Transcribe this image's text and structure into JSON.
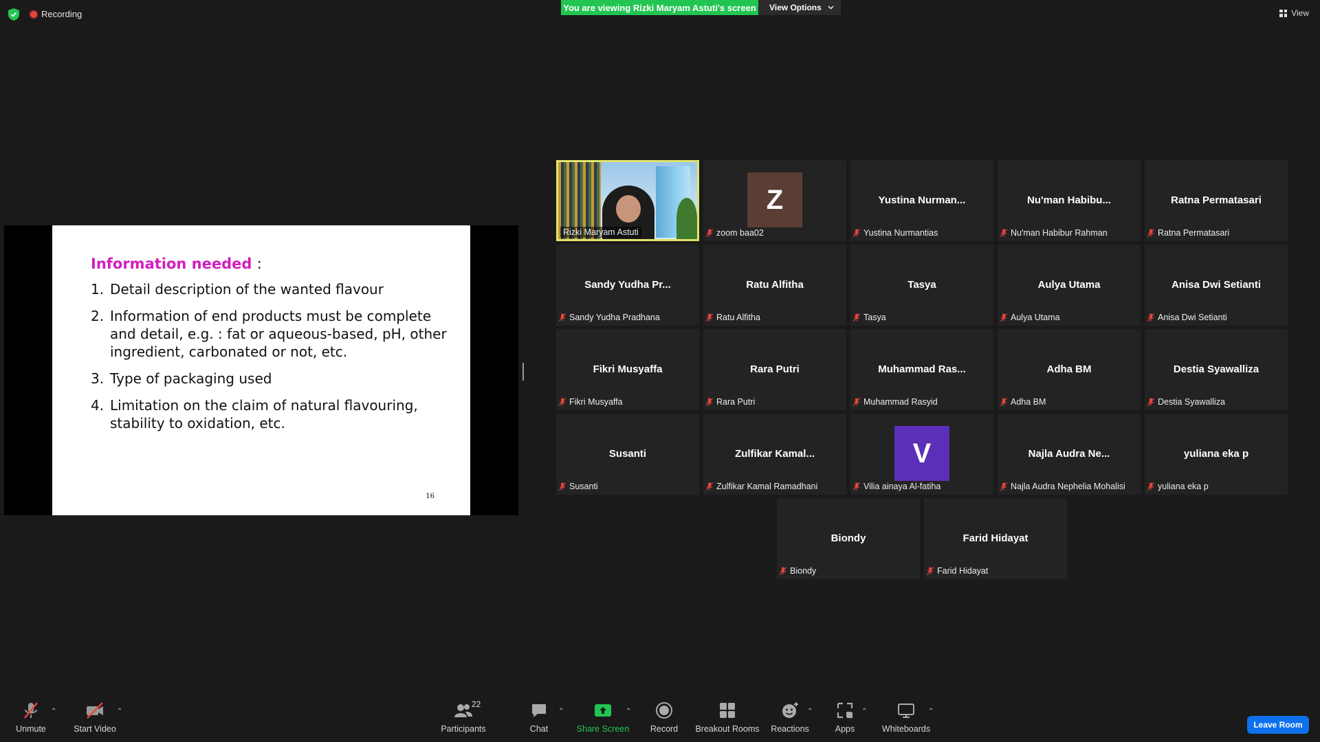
{
  "top": {
    "recording_label": "Recording",
    "viewing_banner": "You are viewing Rizki Maryam Astuti's screen",
    "view_options": "View Options",
    "view_label": "View"
  },
  "slide": {
    "title": "Information needed",
    "title_suffix": ":",
    "items": [
      {
        "num": "1.",
        "text": "Detail description of the wanted flavour"
      },
      {
        "num": "2.",
        "text": "Information of end products must be complete and detail, e.g. : fat or aqueous-based, pH, other ingredient, carbonated or not, etc."
      },
      {
        "num": "3.",
        "text": "Type of packaging used"
      },
      {
        "num": "4.",
        "text": "Limitation on the claim of natural flavouring, stability to oxidation, etc."
      }
    ],
    "page_number": "16"
  },
  "participants": [
    {
      "display": "",
      "label": "Rizki Maryam Astuti",
      "type": "video",
      "muted": false
    },
    {
      "display": "Z",
      "label": "zoom baa02",
      "type": "avatar",
      "avatar_color": "#5a3e36",
      "muted": true
    },
    {
      "display": "Yustina  Nurman...",
      "label": "Yustina Nurmantias",
      "type": "name",
      "muted": true
    },
    {
      "display": "Nu'man  Habibu...",
      "label": "Nu'man Habibur Rahman",
      "type": "name",
      "muted": true
    },
    {
      "display": "Ratna Permatasari",
      "label": "Ratna Permatasari",
      "type": "name",
      "muted": true
    },
    {
      "display": "Sandy  Yudha  Pr...",
      "label": "Sandy Yudha Pradhana",
      "type": "name",
      "muted": true
    },
    {
      "display": "Ratu Alfitha",
      "label": "Ratu Alfitha",
      "type": "name",
      "muted": true
    },
    {
      "display": "Tasya",
      "label": "Tasya",
      "type": "name",
      "muted": true
    },
    {
      "display": "Aulya Utama",
      "label": "Aulya Utama",
      "type": "name",
      "muted": true
    },
    {
      "display": "Anisa Dwi Setianti",
      "label": "Anisa Dwi Setianti",
      "type": "name",
      "muted": true
    },
    {
      "display": "Fikri Musyaffa",
      "label": "Fikri Musyaffa",
      "type": "name",
      "muted": true
    },
    {
      "display": "Rara Putri",
      "label": "Rara Putri",
      "type": "name",
      "muted": true
    },
    {
      "display": "Muhammad  Ras...",
      "label": "Muhammad Rasyid",
      "type": "name",
      "muted": true
    },
    {
      "display": "Adha BM",
      "label": "Adha BM",
      "type": "name",
      "muted": true
    },
    {
      "display": "Destia Syawalliza",
      "label": "Destia Syawalliza",
      "type": "name",
      "muted": true
    },
    {
      "display": "Susanti",
      "label": "Susanti",
      "type": "name",
      "muted": true
    },
    {
      "display": "Zulfikar  Kamal...",
      "label": "Zulfikar Kamal Ramadhani",
      "type": "name",
      "muted": true
    },
    {
      "display": "V",
      "label": "Vilia ainaya Al-fatiha",
      "type": "avatar",
      "avatar_color": "#5b2fb8",
      "muted": true
    },
    {
      "display": "Najla  Audra  Ne...",
      "label": "Najla Audra Nephelia Mohalisi",
      "type": "name",
      "muted": true
    },
    {
      "display": "yuliana eka p",
      "label": "yuliana eka p",
      "type": "name",
      "muted": true
    },
    {
      "display": "Biondy",
      "label": "Biondy",
      "type": "name",
      "muted": true
    },
    {
      "display": "Farid Hidayat",
      "label": "Farid Hidayat",
      "type": "name",
      "muted": true
    }
  ],
  "toolbar": {
    "unmute": "Unmute",
    "start_video": "Start Video",
    "participants": "Participants",
    "participants_count": "22",
    "chat": "Chat",
    "share_screen": "Share Screen",
    "record": "Record",
    "breakout_rooms": "Breakout Rooms",
    "reactions": "Reactions",
    "apps": "Apps",
    "whiteboards": "Whiteboards",
    "leave": "Leave Room"
  },
  "colors": {
    "share_green": "#23c552",
    "active_speaker": "#e1e46a",
    "leave_blue": "#0e71eb",
    "slide_title": "#d21ec0",
    "mute_red": "#e8463b"
  }
}
